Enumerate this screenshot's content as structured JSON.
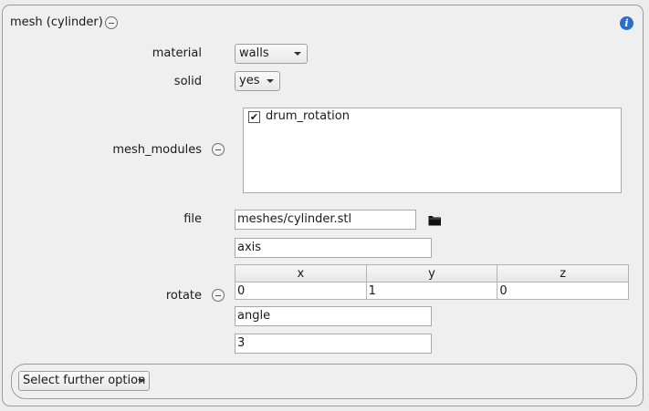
{
  "header": {
    "title": "mesh (cylinder)"
  },
  "material": {
    "label": "material",
    "value": "walls"
  },
  "solid": {
    "label": "solid",
    "value": "yes"
  },
  "mesh_modules": {
    "label": "mesh_modules",
    "items": [
      {
        "label": "drum_rotation",
        "checked": true
      }
    ]
  },
  "file": {
    "label": "file",
    "value": "meshes/cylinder.stl"
  },
  "rotate": {
    "label": "rotate",
    "axis_label": "axis",
    "columns": [
      "x",
      "y",
      "z"
    ],
    "values": [
      "0",
      "1",
      "0"
    ],
    "angle_label": "angle",
    "angle_value": "3"
  },
  "further": {
    "label": "Select further option"
  }
}
